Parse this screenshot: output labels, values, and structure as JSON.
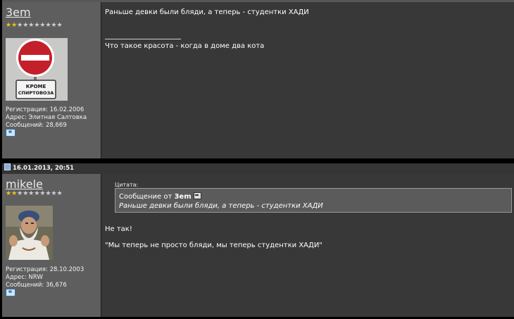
{
  "posts": [
    {
      "username": "3em",
      "stars_filled": 2,
      "stars_total": 10,
      "registration": "Регистрация: 16.02.2006",
      "address": "Адрес: Элитная Салтовка",
      "messages": "Сообщений: 28,669",
      "avatar": {
        "sign_text_1": "КРОМЕ",
        "sign_text_2": "СПИРТОВОЗА"
      },
      "body": "Раньше девки были бляди, а теперь - студентки ХАДИ",
      "signature": "Что такое красота - когда в доме два кота"
    },
    {
      "date": "16.01.2013, 20:51",
      "username": "mikele",
      "stars_filled": 2,
      "stars_total": 10,
      "registration": "Регистрация: 28.10.2003",
      "address": "Адрес: NRW",
      "messages": "Сообщений: 36,676",
      "quote": {
        "label": "Цитата:",
        "prefix": "Сообщение от",
        "author": "3em",
        "text": "Раньше девки были бляди, а теперь - студентки ХАДИ"
      },
      "body_line1": "Не так!",
      "body_line2": "\"Мы теперь не просто бляди, мы теперь студентки ХАДИ\""
    }
  ],
  "icons": {
    "message": "message-icon",
    "date": "post-document-icon",
    "view_post": "view-post-icon"
  },
  "colors": {
    "star_on": "#f0c020",
    "star_off": "#cfcfcf"
  }
}
